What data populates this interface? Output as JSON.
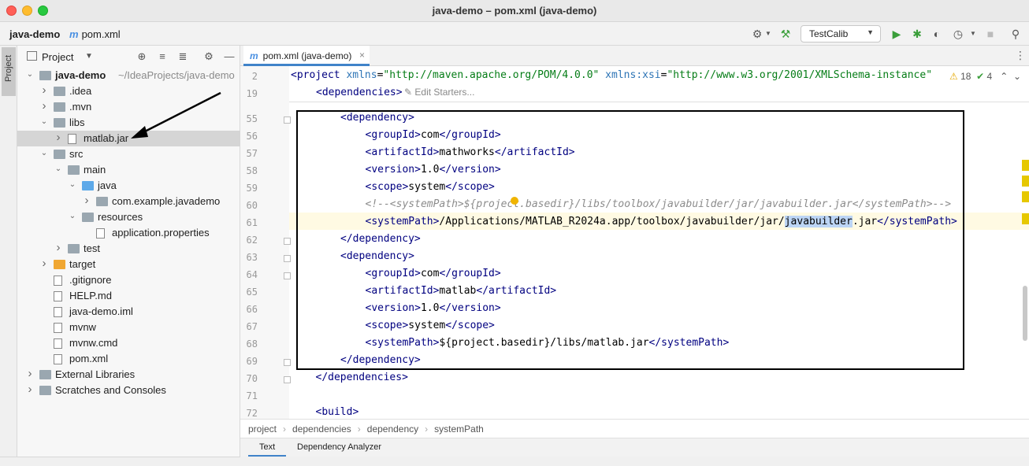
{
  "window": {
    "title": "java-demo – pom.xml (java-demo)"
  },
  "nav": {
    "project": "java-demo",
    "file": "pom.xml",
    "run_config": "TestCalib"
  },
  "left_strip": {
    "project_label": "Project"
  },
  "project_panel": {
    "title": "Project",
    "tree": [
      {
        "label": "java-demo",
        "extra": "~/IdeaProjects/java-demo",
        "indent": 0,
        "arrow": "down",
        "icon": "folder",
        "bold": true
      },
      {
        "label": ".idea",
        "indent": 1,
        "arrow": "right",
        "icon": "folder"
      },
      {
        "label": ".mvn",
        "indent": 1,
        "arrow": "right",
        "icon": "folder"
      },
      {
        "label": "libs",
        "indent": 1,
        "arrow": "down",
        "icon": "folder"
      },
      {
        "label": "matlab.jar",
        "indent": 2,
        "arrow": "right",
        "icon": "jar",
        "selected": true
      },
      {
        "label": "src",
        "indent": 1,
        "arrow": "down",
        "icon": "folder"
      },
      {
        "label": "main",
        "indent": 2,
        "arrow": "down",
        "icon": "folder"
      },
      {
        "label": "java",
        "indent": 3,
        "arrow": "down",
        "icon": "folder-blue"
      },
      {
        "label": "com.example.javademo",
        "indent": 4,
        "arrow": "right",
        "icon": "package"
      },
      {
        "label": "resources",
        "indent": 3,
        "arrow": "down",
        "icon": "folder"
      },
      {
        "label": "application.properties",
        "indent": 4,
        "arrow": "",
        "icon": "file"
      },
      {
        "label": "test",
        "indent": 2,
        "arrow": "right",
        "icon": "folder"
      },
      {
        "label": "target",
        "indent": 1,
        "arrow": "right",
        "icon": "folder-orange"
      },
      {
        "label": ".gitignore",
        "indent": 1,
        "arrow": "",
        "icon": "file"
      },
      {
        "label": "HELP.md",
        "indent": 1,
        "arrow": "",
        "icon": "file"
      },
      {
        "label": "java-demo.iml",
        "indent": 1,
        "arrow": "",
        "icon": "file"
      },
      {
        "label": "mvnw",
        "indent": 1,
        "arrow": "",
        "icon": "file"
      },
      {
        "label": "mvnw.cmd",
        "indent": 1,
        "arrow": "",
        "icon": "file"
      },
      {
        "label": "pom.xml",
        "indent": 1,
        "arrow": "",
        "icon": "maven"
      },
      {
        "label": "External Libraries",
        "indent": 0,
        "arrow": "right",
        "icon": "libraries"
      },
      {
        "label": "Scratches and Consoles",
        "indent": 0,
        "arrow": "right",
        "icon": "scratches"
      }
    ]
  },
  "editor": {
    "tab": "pom.xml (java-demo)",
    "edit_starters": "Edit Starters...",
    "inspections": {
      "warnings": "18",
      "ok": "4"
    },
    "line_numbers": [
      "2",
      "19",
      "55",
      "56",
      "57",
      "58",
      "59",
      "60",
      "61",
      "62",
      "63",
      "64",
      "65",
      "66",
      "67",
      "68",
      "69",
      "70",
      "71",
      "72"
    ],
    "sticky_line2": {
      "t_open": "<project ",
      "a1": "xmlns",
      "eq1": "=",
      "v1": "\"http://maven.apache.org/POM/4.0.0\"",
      "a2": " xmlns:xsi",
      "eq2": "=",
      "v2": "\"http://www.w3.org/2001/XMLSchema-instance\""
    },
    "sticky_line19": "<dependencies>",
    "lines": {
      "l55": "<dependency>",
      "l56": {
        "open": "<groupId>",
        "text": "com",
        "close": "</groupId>"
      },
      "l57": {
        "open": "<artifactId>",
        "text": "mathworks",
        "close": "</artifactId>"
      },
      "l58": {
        "open": "<version>",
        "text": "1.0",
        "close": "</version>"
      },
      "l59": {
        "open": "<scope>",
        "text": "system",
        "close": "</scope>"
      },
      "l60": "<!--<systemPath>${project.basedir}/libs/toolbox/javabuilder/jar/javabuilder.jar</systemPath>-->",
      "l61": {
        "open": "<systemPath>",
        "pre": "/Applications/MATLAB_R2024a.app/toolbox/javabuilder/jar/",
        "hl": "javabuilder",
        "post": ".jar",
        "close": "</systemPath>"
      },
      "l62": "</dependency>",
      "l63": "<dependency>",
      "l64": {
        "open": "<groupId>",
        "text": "com",
        "close": "</groupId>"
      },
      "l65": {
        "open": "<artifactId>",
        "text": "matlab",
        "close": "</artifactId>"
      },
      "l66": {
        "open": "<version>",
        "text": "1.0",
        "close": "</version>"
      },
      "l67": {
        "open": "<scope>",
        "text": "system",
        "close": "</scope>"
      },
      "l68": {
        "open": "<systemPath>",
        "text": "${project.basedir}/libs/matlab.jar",
        "close": "</systemPath>"
      },
      "l69": "</dependency>",
      "l70": "</dependencies>",
      "l71": "",
      "l72": "<build>"
    }
  },
  "breadcrumbs": [
    "project",
    "dependencies",
    "dependency",
    "systemPath"
  ],
  "bottom_tabs": {
    "text": "Text",
    "dependency_analyzer": "Dependency Analyzer"
  }
}
